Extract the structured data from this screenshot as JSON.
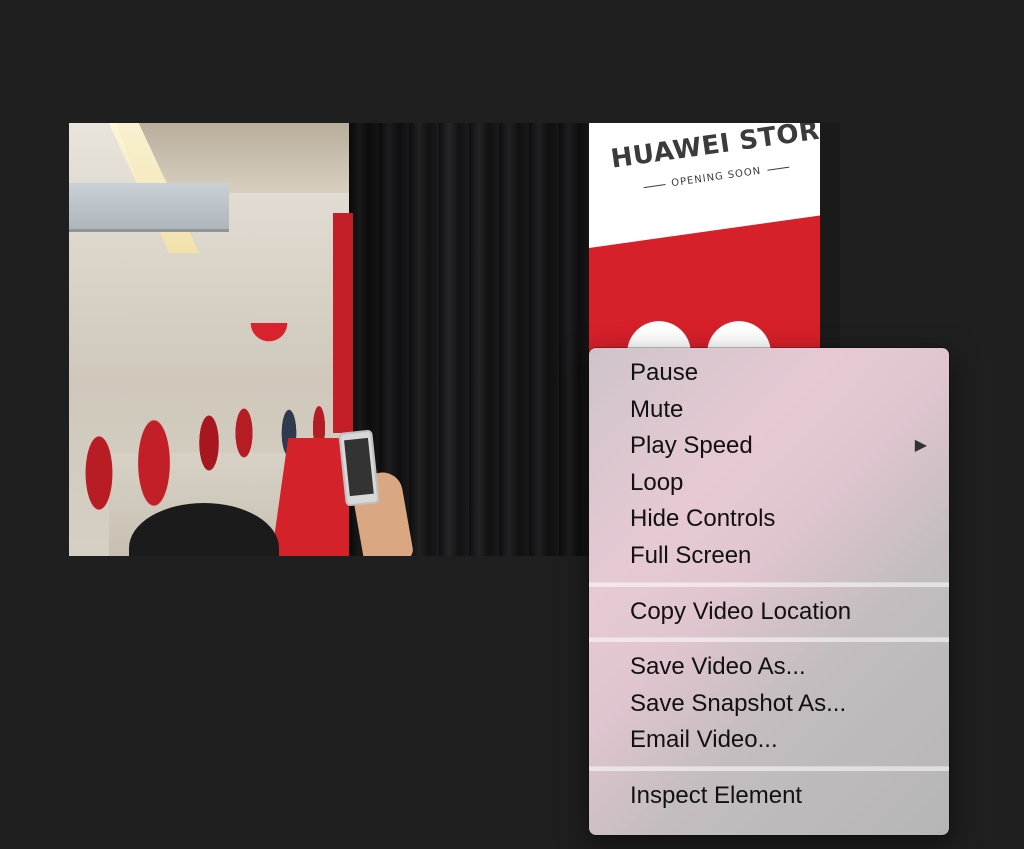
{
  "video": {
    "sign_title": "HUAWEI STORE",
    "sign_subtitle": "OPENING SOON"
  },
  "context_menu": {
    "sections": [
      {
        "items": [
          {
            "label": "Pause"
          },
          {
            "label": "Mute"
          },
          {
            "label": "Play Speed",
            "submenu_indicator": "▶"
          },
          {
            "label": "Loop"
          },
          {
            "label": "Hide Controls"
          },
          {
            "label": "Full Screen"
          }
        ]
      },
      {
        "items": [
          {
            "label": "Copy Video Location"
          }
        ]
      },
      {
        "items": [
          {
            "label": "Save Video As..."
          },
          {
            "label": "Save Snapshot As..."
          },
          {
            "label": "Email Video..."
          }
        ]
      },
      {
        "items": [
          {
            "label": "Inspect Element"
          }
        ]
      }
    ]
  },
  "colors": {
    "background": "#1f1f1f",
    "sign_red": "#d6202a"
  },
  "icons": {
    "submenu_arrow": "triangle-right-icon"
  }
}
